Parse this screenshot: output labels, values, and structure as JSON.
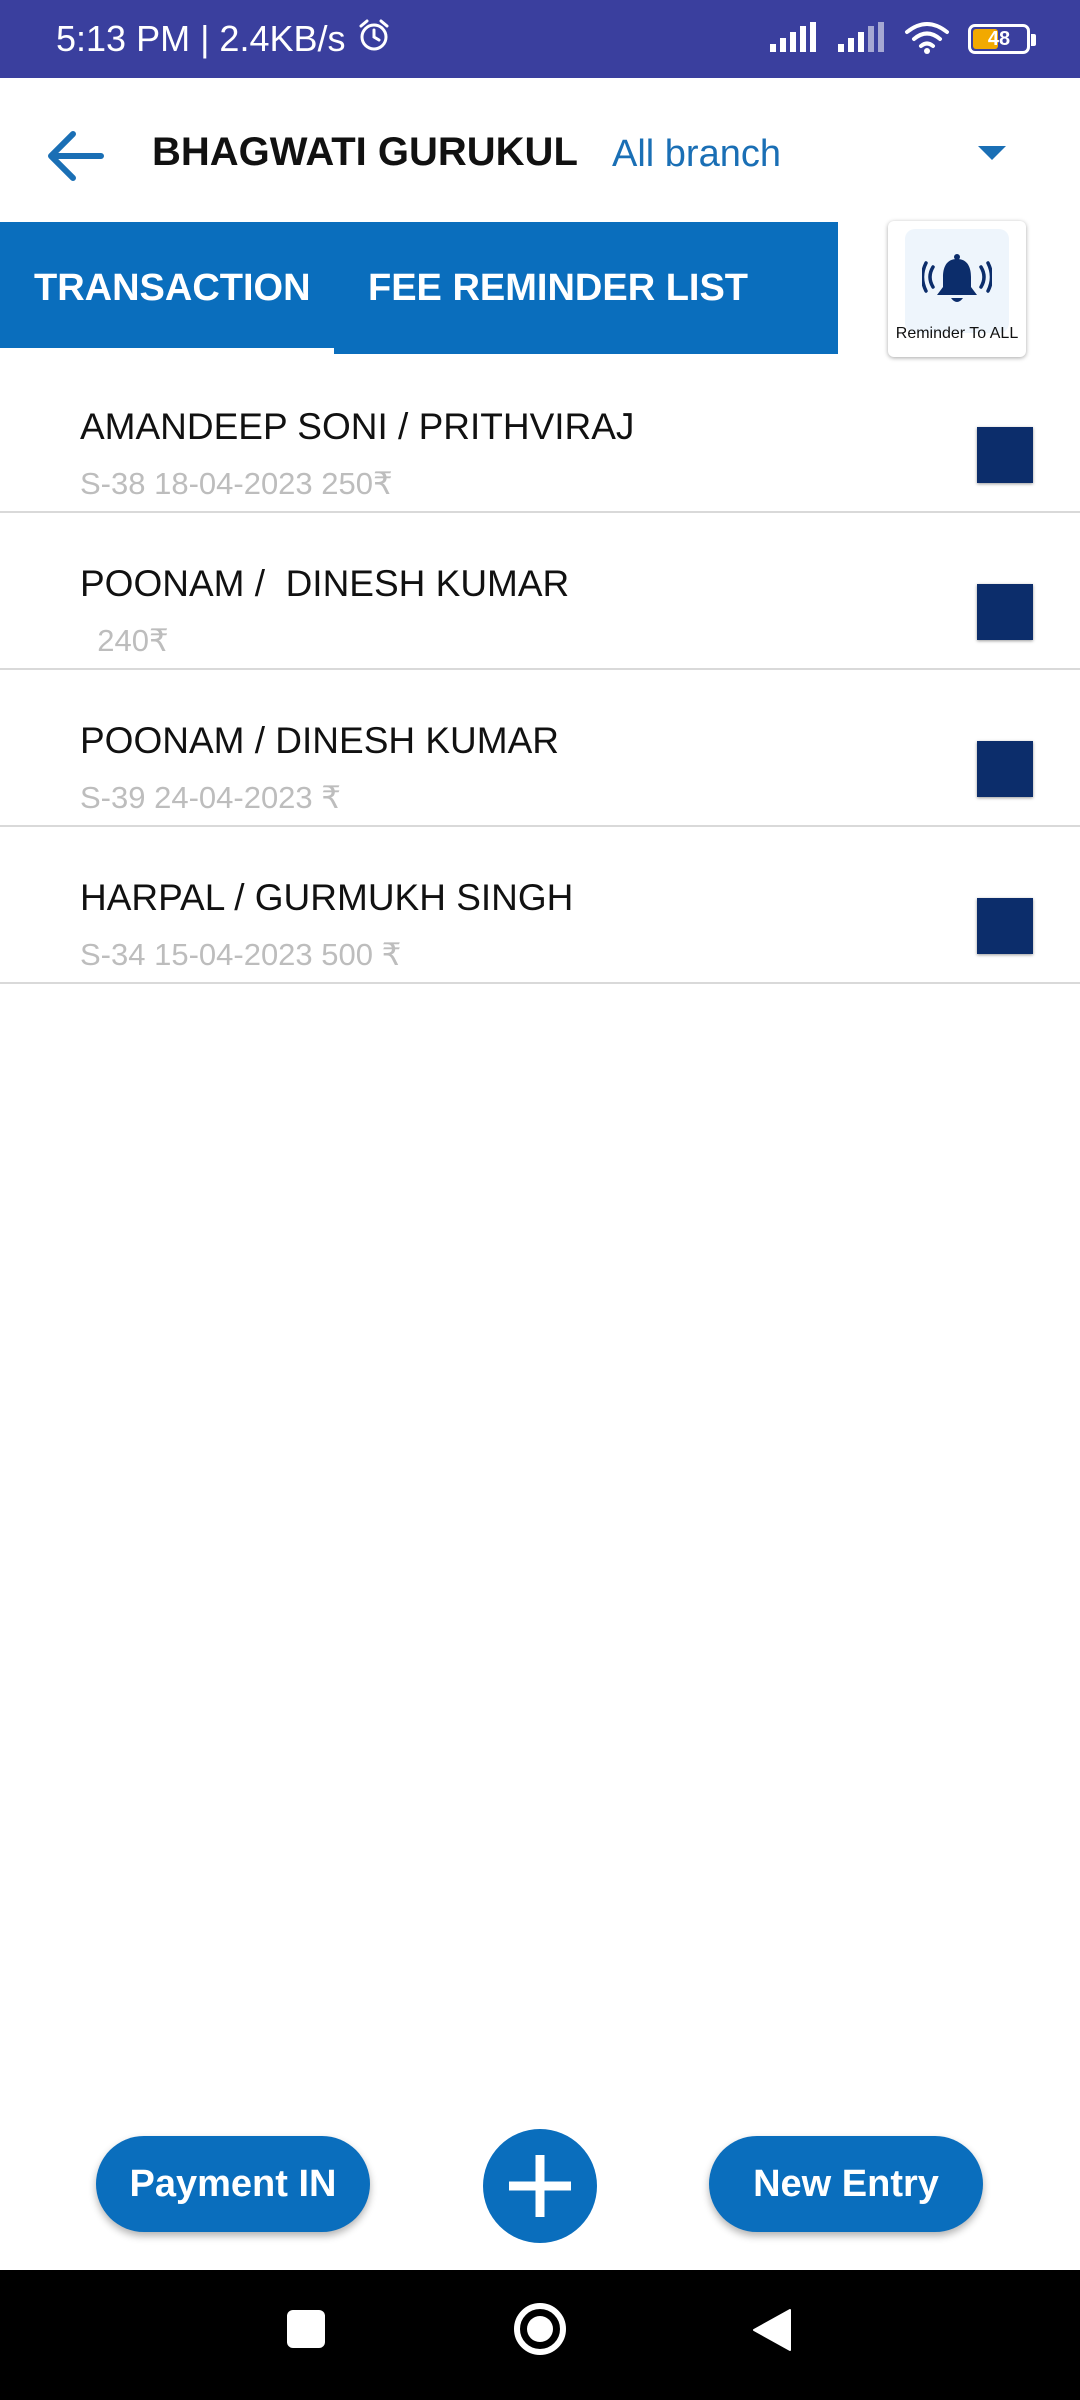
{
  "status_bar": {
    "time_speed": "5:13 PM | 2.4KB/s",
    "battery_level": "48"
  },
  "header": {
    "school_name": "BHAGWATI GURUKUL",
    "branch_selected": "All branch"
  },
  "tabs": [
    {
      "label": "TRANSACTION",
      "active": true
    },
    {
      "label": "FEE REMINDER LIST",
      "active": false
    }
  ],
  "reminder_all": {
    "label": "Reminder To ALL",
    "icon": "bell-ringing-icon"
  },
  "list": {
    "items": [
      {
        "title": "AMANDEEP SONI / PRITHVIRAJ",
        "subtitle": "S-38 18-04-2023 250₹"
      },
      {
        "title": "POONAM /  DINESH KUMAR",
        "subtitle": "  240₹"
      },
      {
        "title": "POONAM / DINESH KUMAR",
        "subtitle": "S-39 24-04-2023 ₹"
      },
      {
        "title": "HARPAL / GURMUKH SINGH",
        "subtitle": "S-34 15-04-2023 500 ₹"
      }
    ]
  },
  "actions": {
    "payment_in": "Payment IN",
    "new_entry": "New Entry"
  },
  "colors": {
    "status_bar": "#3a3f9e",
    "primary": "#0a6ebd",
    "checkbox": "#0c2d6b",
    "subtitle": "#bdbdbd"
  }
}
